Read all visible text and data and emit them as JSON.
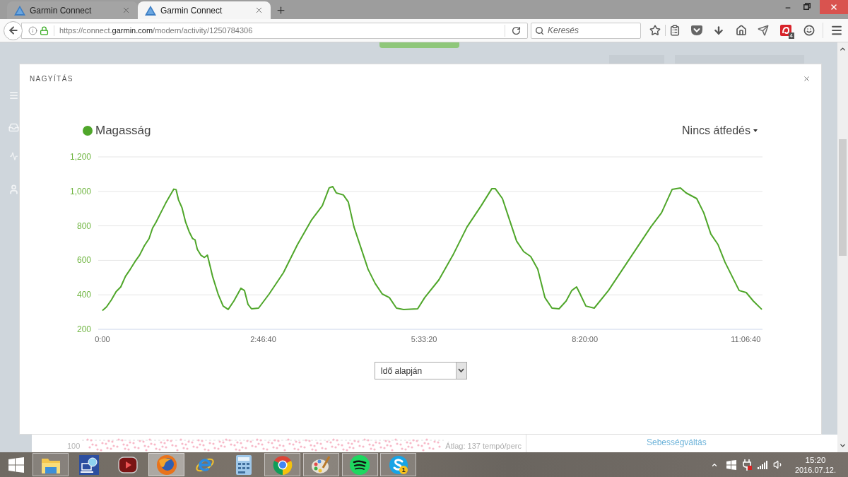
{
  "browser": {
    "tabs": [
      {
        "title": "Garmin Connect",
        "selected": false
      },
      {
        "title": "Garmin Connect",
        "selected": true
      }
    ],
    "url": "https://connect.**garmin.com**/modern/activity/1250784306",
    "search": {
      "placeholder": "Keresés"
    },
    "extension_badge": "4"
  },
  "page": {
    "axis_label": "100",
    "average": "Átlag: 137 tempó/perc",
    "link": "Sebességváltás"
  },
  "modal": {
    "title": "NAGYÍTÁS",
    "overlay_menu": "Nincs átfedés",
    "chart_data": {
      "type": "line",
      "grid": true,
      "x": [
        0,
        260,
        560,
        850,
        1140,
        1430,
        1730,
        2020,
        2310,
        2610,
        2900,
        3120,
        3340,
        3630,
        3930,
        4220,
        4440,
        4580,
        4730,
        4950,
        5170,
        5390,
        5610,
        5760,
        5900,
        6120,
        6340,
        6530,
        6710,
        6850,
        7210,
        7510,
        7820,
        8170,
        8610,
        8830,
        9050,
        9270,
        9710,
        10370,
        11250,
        12130,
        13010,
        13670,
        14100,
        14320,
        14540,
        14980,
        15290,
        15640,
        16080,
        16520,
        16960,
        17400,
        17840,
        18280,
        18720,
        19600,
        20040,
        20920,
        21790,
        22670,
        23550,
        24210,
        24430,
        24870,
        25310,
        25750,
        26190,
        26630,
        27070,
        27510,
        27950,
        28390,
        28830,
        29180,
        29480,
        29700,
        30060,
        30580,
        31460,
        32340,
        33220,
        34100,
        34760,
        35420,
        35940,
        36290,
        36950,
        37390,
        37830,
        38270,
        38710,
        39150,
        39590,
        40030,
        40470,
        41000
      ],
      "series": [
        {
          "name": "Magasság",
          "color": "#4fa62a",
          "values": [
            309,
            330,
            371,
            418,
            446,
            507,
            548,
            592,
            630,
            685,
            726,
            787,
            822,
            876,
            931,
            979,
            1013,
            1010,
            951,
            904,
            822,
            767,
            726,
            719,
            664,
            630,
            617,
            630,
            562,
            507,
            400,
            335,
            315,
            364,
            438,
            425,
            345,
            319,
            323,
            405,
            528,
            692,
            835,
            917,
            1020,
            1028,
            991,
            979,
            938,
            794,
            671,
            548,
            466,
            405,
            384,
            323,
            315,
            319,
            384,
            487,
            630,
            794,
            917,
            1015,
            1015,
            958,
            835,
            712,
            651,
            622,
            548,
            384,
            323,
            319,
            364,
            425,
            446,
            405,
            335,
            323,
            425,
            548,
            671,
            794,
            876,
            1011,
            1020,
            991,
            958,
            876,
            753,
            692,
            589,
            507,
            425,
            413,
            364,
            315
          ]
        }
      ],
      "xlim": [
        -260,
        41040
      ],
      "ylim": [
        200,
        1200
      ],
      "xticks": [
        {
          "value": 0,
          "label": "0:00"
        },
        {
          "value": 10000,
          "label": "2:46:40"
        },
        {
          "value": 20000,
          "label": "5:33:20"
        },
        {
          "value": 30000,
          "label": "8:20:00"
        },
        {
          "value": 40000,
          "label": "11:06:40"
        }
      ],
      "yticks": [
        {
          "value": 200,
          "label": "200"
        },
        {
          "value": 400,
          "label": "400"
        },
        {
          "value": 600,
          "label": "600"
        },
        {
          "value": 800,
          "label": "800"
        },
        {
          "value": 1000,
          "label": "1,000"
        },
        {
          "value": 1200,
          "label": "1,200"
        }
      ]
    },
    "axis_select": {
      "value": "Idő alapján"
    }
  },
  "taskbar": {
    "apps": [
      {
        "running": true,
        "selected": false
      },
      {
        "running": false,
        "selected": false
      },
      {
        "running": false,
        "selected": false
      },
      {
        "running": true,
        "selected": true
      },
      {
        "running": false,
        "selected": false
      },
      {
        "running": false,
        "selected": false
      },
      {
        "running": true,
        "selected": false
      },
      {
        "running": true,
        "selected": false
      },
      {
        "running": true,
        "selected": false
      },
      {
        "running": true,
        "selected": false,
        "badge": "1"
      }
    ],
    "clock": {
      "time": "15:20",
      "date": "2016.07.12."
    }
  }
}
